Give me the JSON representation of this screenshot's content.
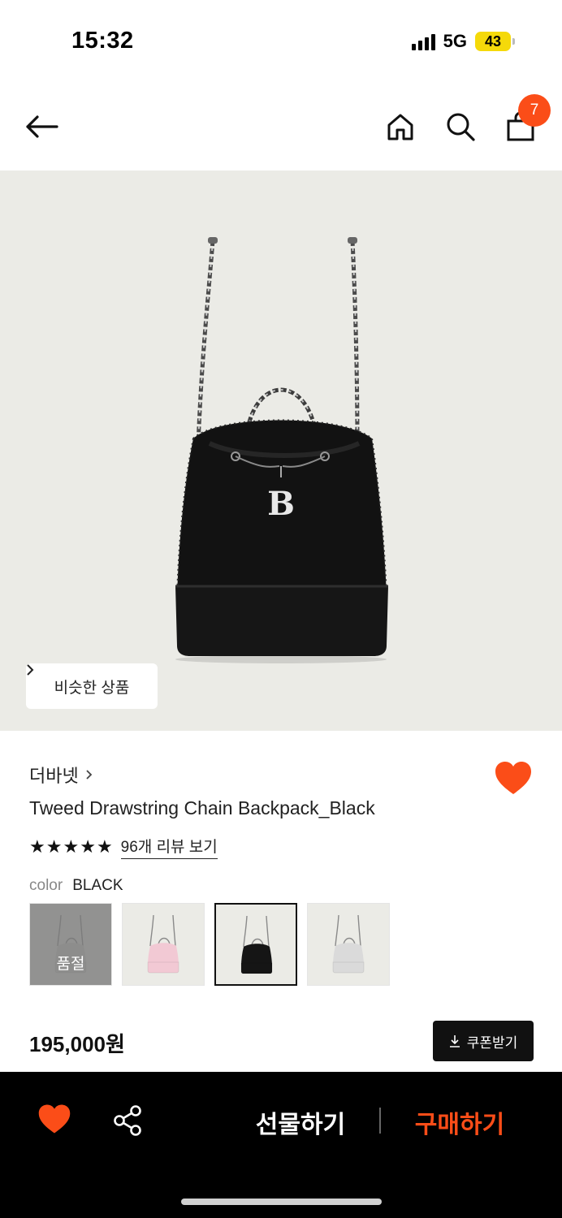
{
  "status": {
    "time": "15:32",
    "network": "5G",
    "battery": "43"
  },
  "nav": {
    "cart_count": "7"
  },
  "hero": {
    "similar_label": "비슷한 상품",
    "bag_logo": "B"
  },
  "product": {
    "brand": "더바넷",
    "name": "Tweed Drawstring Chain Backpack_Black",
    "rating_stars": 5,
    "review_link": "96개 리뷰 보기",
    "color_label": "color",
    "color_value": "BLACK",
    "swatches": [
      {
        "color": "#d6d6d2",
        "sold_out_label": "품절",
        "selected": false
      },
      {
        "color": "#f2c9d4",
        "selected": false
      },
      {
        "color": "#151515",
        "selected": true
      },
      {
        "color": "#dadada",
        "selected": false
      }
    ],
    "price": "195,000원",
    "coupon_label": "쿠폰받기"
  },
  "bottom_bar": {
    "gift_label": "선물하기",
    "buy_label": "구매하기"
  },
  "colors": {
    "accent": "#fb4d18",
    "battery": "#f5d90a",
    "hero_bg": "#ebebe6"
  }
}
